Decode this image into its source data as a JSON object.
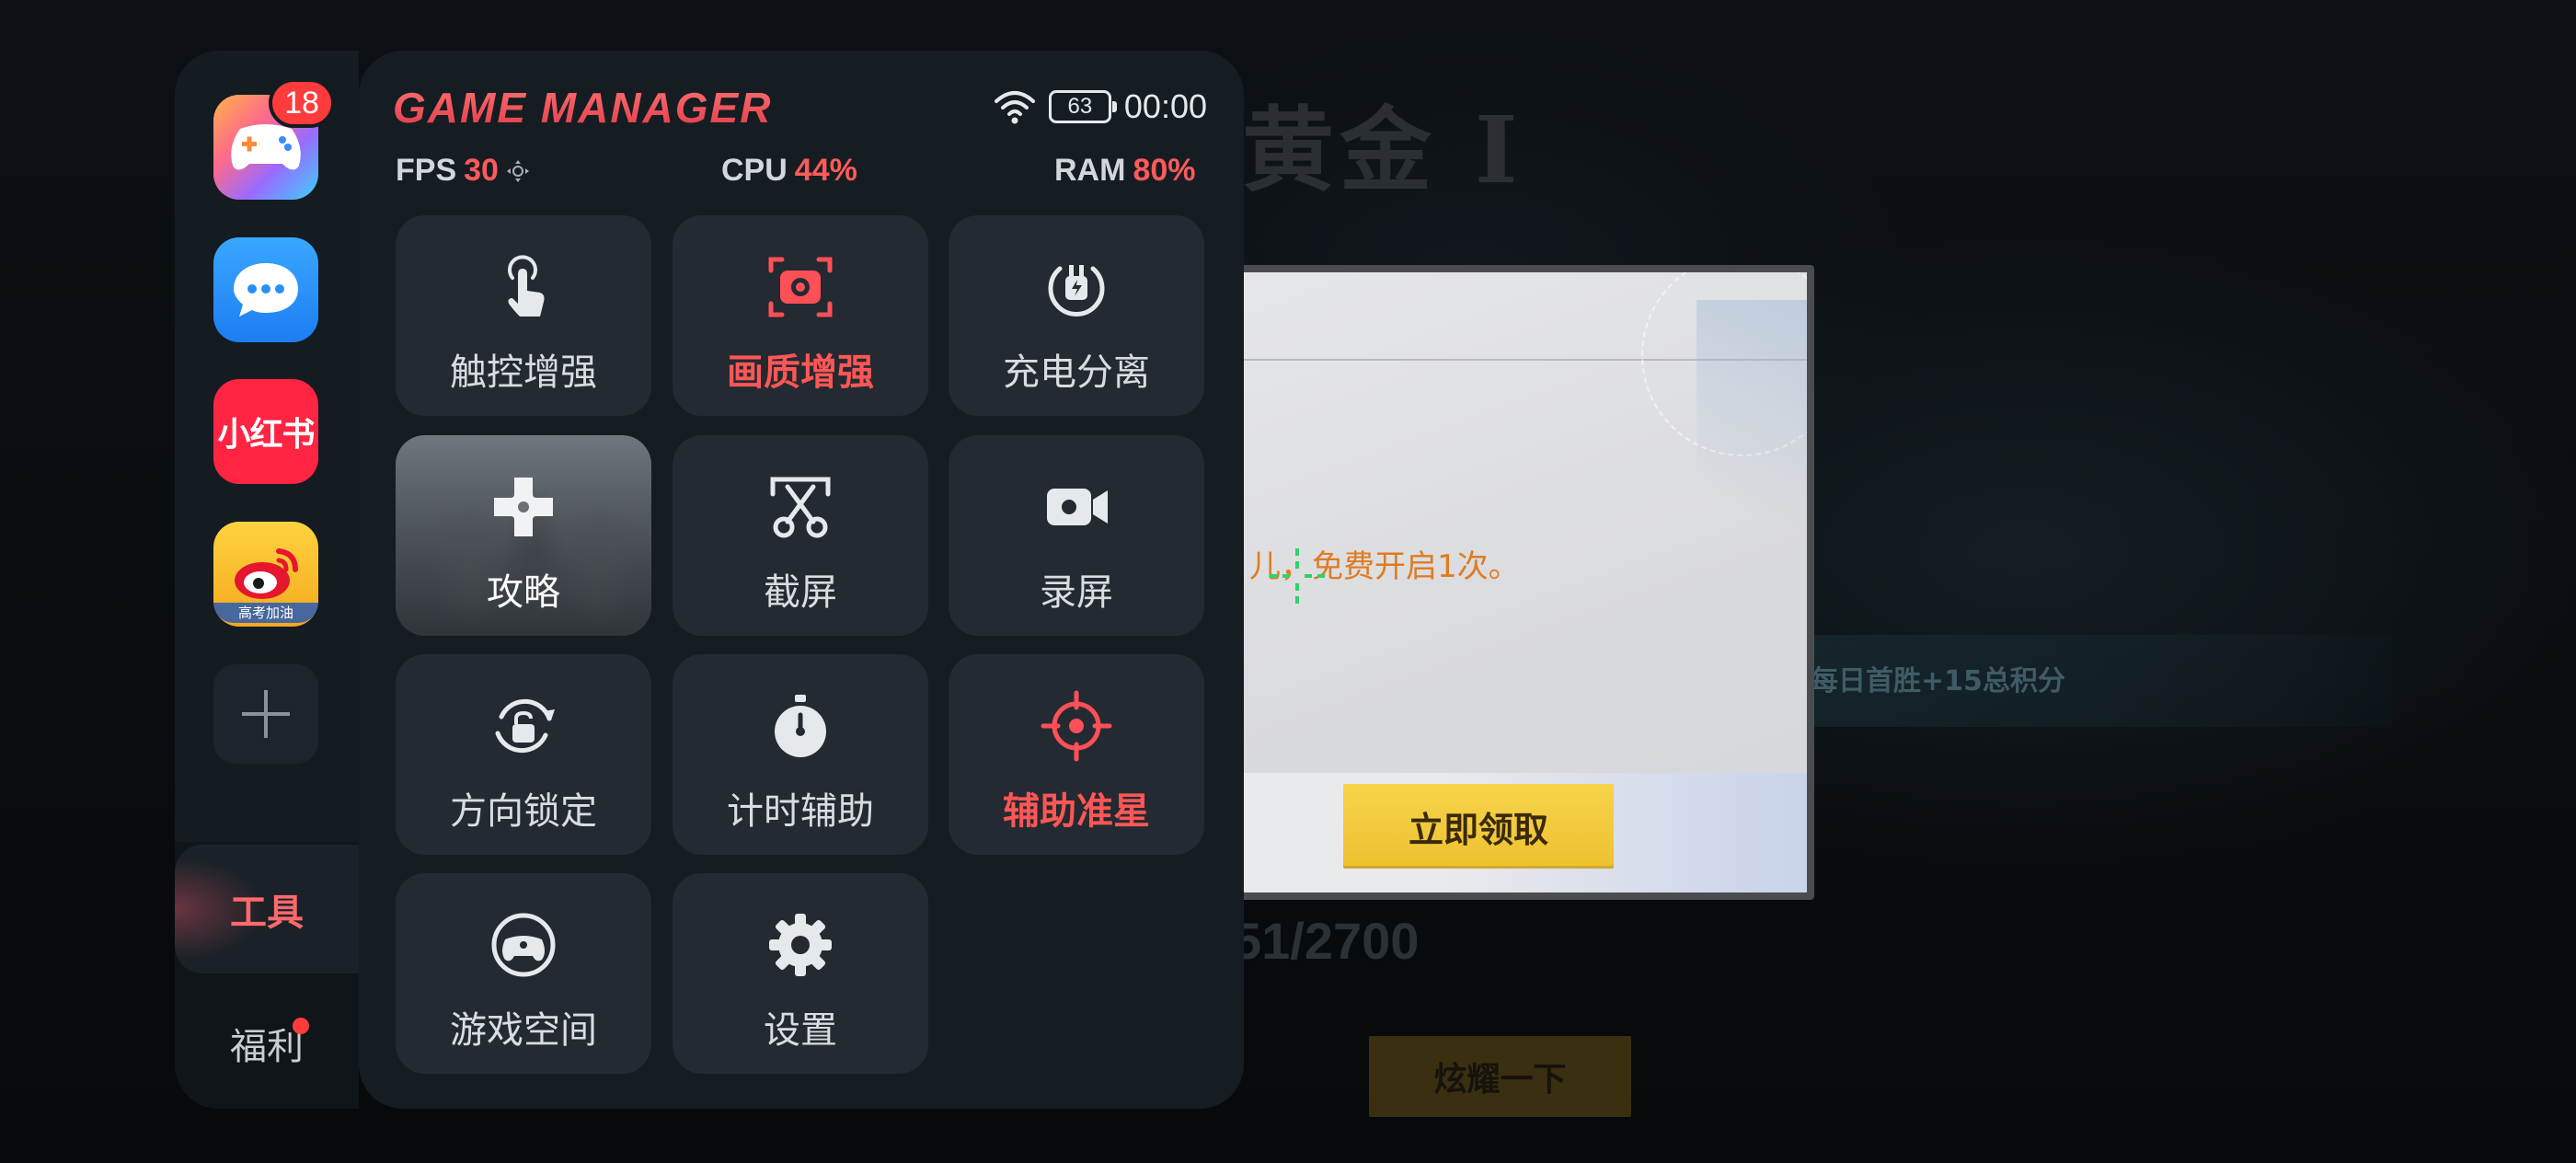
{
  "game": {
    "rank_title": "黄金 I",
    "dialog_text": "，免费开启1次。",
    "dialog_text_prefix": "儿",
    "claim_button": "立即领取",
    "daily_bonus": "每日首胜+15总积分",
    "progress": "51/2700",
    "show_off_button": "炫耀一下"
  },
  "rail": {
    "apps": [
      {
        "name": "game-center",
        "badge": "18"
      },
      {
        "name": "messages"
      },
      {
        "name": "xiaohongshu",
        "label": "小红书"
      },
      {
        "name": "weibo",
        "tag": "高考加油"
      }
    ],
    "tabs": [
      {
        "label": "工具",
        "active": true
      },
      {
        "label": "福利",
        "dot": true
      }
    ]
  },
  "header": {
    "logo": "GAME MANAGER",
    "battery": "63",
    "clock": "00:00"
  },
  "metrics": {
    "fps_label": "FPS",
    "fps_value": "30",
    "cpu_label": "CPU",
    "cpu_value": "44%",
    "ram_label": "RAM",
    "ram_value": "80%"
  },
  "tools": [
    {
      "label": "触控增强",
      "icon": "touch-enhance-icon",
      "active": false
    },
    {
      "label": "画质增强",
      "icon": "image-quality-icon",
      "active": true
    },
    {
      "label": "充电分离",
      "icon": "charge-separation-icon",
      "active": false
    },
    {
      "label": "攻略",
      "icon": "guide-icon",
      "active": false
    },
    {
      "label": "截屏",
      "icon": "screenshot-icon",
      "active": false
    },
    {
      "label": "录屏",
      "icon": "screen-record-icon",
      "active": false
    },
    {
      "label": "方向锁定",
      "icon": "rotation-lock-icon",
      "active": false
    },
    {
      "label": "计时辅助",
      "icon": "timer-icon",
      "active": false
    },
    {
      "label": "辅助准星",
      "icon": "crosshair-icon",
      "active": true
    },
    {
      "label": "游戏空间",
      "icon": "game-space-icon",
      "active": false
    },
    {
      "label": "设置",
      "icon": "settings-icon",
      "active": false
    }
  ],
  "colors": {
    "accent": "#ff5656",
    "panel": "#151d23",
    "tile": "#232a31"
  }
}
